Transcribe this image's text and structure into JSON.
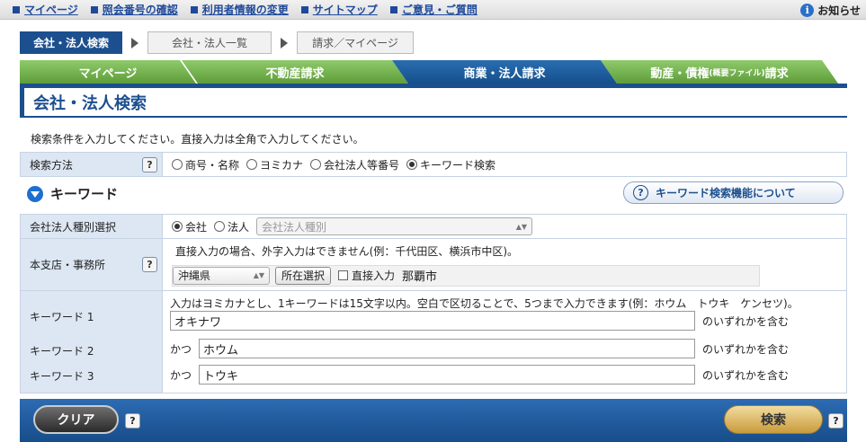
{
  "topnav": {
    "items": [
      "マイページ",
      "照会番号の確認",
      "利用者情報の変更",
      "サイトマップ",
      "ご意見・ご質問"
    ],
    "notice": "お知らせ"
  },
  "steps": [
    "会社・法人検索",
    "会社・法人一覧",
    "請求／マイページ"
  ],
  "tabs": [
    {
      "label": "マイページ"
    },
    {
      "label": "不動産請求"
    },
    {
      "label": "商業・法人請求"
    },
    {
      "label_main": "動産・債権",
      "label_small": "(概要ファイル)",
      "label_tail": "請求"
    }
  ],
  "page_title": "会社・法人検索",
  "instruction": "検索条件を入力してください。直接入力は全角で入力してください。",
  "help_mark": "?",
  "search_method": {
    "label": "検索方法",
    "options": [
      "商号・名称",
      "ヨミカナ",
      "会社法人等番号",
      "キーワード検索"
    ],
    "selected": 3
  },
  "keyword_section": {
    "title": "キーワード",
    "help_button": "キーワード検索機能について"
  },
  "corp_type": {
    "label": "会社法人種別選択",
    "options": [
      "会社",
      "法人"
    ],
    "selected": 0,
    "select_value": "会社法人種別"
  },
  "office": {
    "label": "本支店・事務所",
    "note": "直接入力の場合、外字入力はできません(例：千代田区、横浜市中区)。",
    "prefecture": "沖縄県",
    "locate_button": "所在選択",
    "direct_label": "直接入力",
    "city": "那覇市"
  },
  "keywords": {
    "note": "入力はヨミカナとし、1キーワードは15文字以内。空白で区切ることで、5つまで入力できます(例：ホウム　トウキ　ケンセツ)。",
    "and_label": "かつ",
    "suffix": "のいずれかを含む",
    "rows": [
      {
        "label": "キーワード 1",
        "value": "オキナワ"
      },
      {
        "label": "キーワード 2",
        "value": "ホウム"
      },
      {
        "label": "キーワード 3",
        "value": "トウキ"
      }
    ]
  },
  "buttons": {
    "clear": "クリア",
    "search": "検索"
  }
}
